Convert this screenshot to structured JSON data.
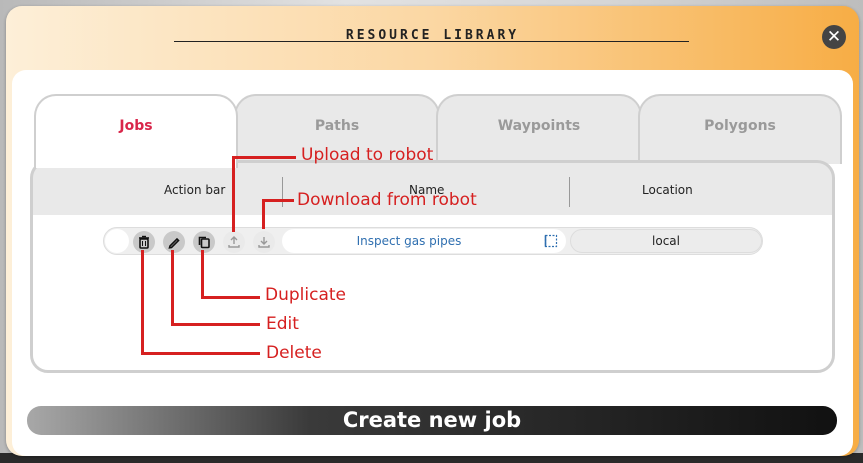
{
  "modal": {
    "title": "RESOURCE LIBRARY",
    "close_icon": "close-icon"
  },
  "tabs": [
    {
      "label": "Jobs",
      "active": true
    },
    {
      "label": "Paths",
      "active": false
    },
    {
      "label": "Waypoints",
      "active": false
    },
    {
      "label": "Polygons",
      "active": false
    }
  ],
  "table": {
    "headers": {
      "action_bar": "Action bar",
      "name": "Name",
      "location": "Location"
    },
    "rows": [
      {
        "name": "Inspect gas pipes",
        "location": "local"
      }
    ]
  },
  "annotations": {
    "upload": "Upload to robot",
    "download": "Download from robot",
    "duplicate": "Duplicate",
    "edit": "Edit",
    "delete": "Delete"
  },
  "create_button": "Create new job",
  "colors": {
    "accent": "#d9264a",
    "annotation": "#d62020",
    "link": "#2f6fb0",
    "modal_gradient_end": "#f7ad45"
  }
}
